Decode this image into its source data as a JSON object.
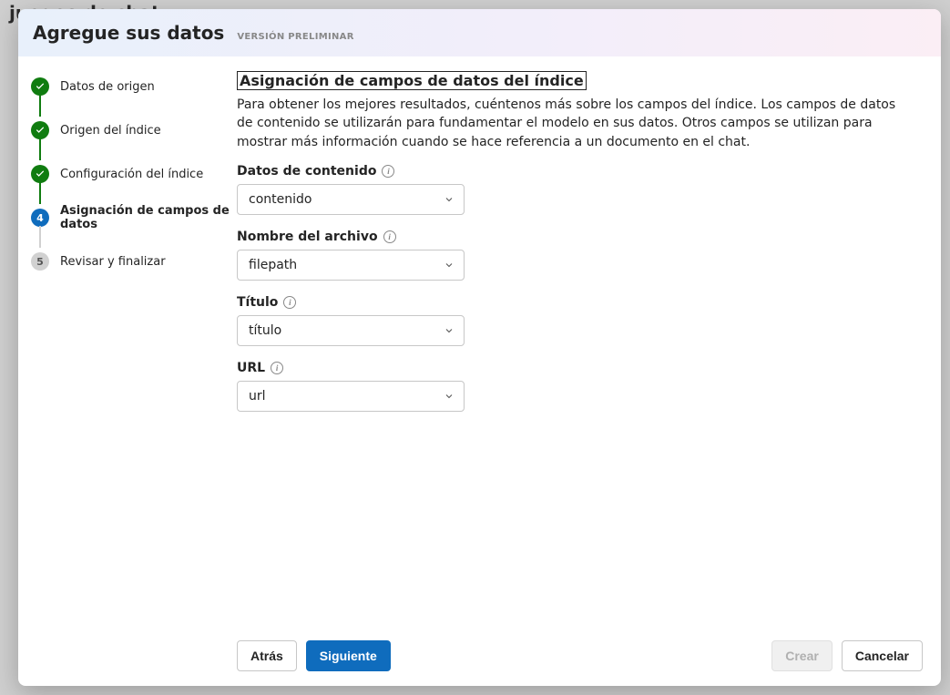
{
  "background": {
    "title": "juegos de chat"
  },
  "header": {
    "title": "Agregue sus datos",
    "badge": "VERSIÓN PRELIMINAR"
  },
  "stepper": {
    "steps": [
      {
        "label": "Datos de origen",
        "state": "done"
      },
      {
        "label": "Origen del índice",
        "state": "done"
      },
      {
        "label": "Configuración del índice",
        "state": "done"
      },
      {
        "label": "Asignación de campos de datos",
        "state": "active",
        "num": "4"
      },
      {
        "label": "Revisar y finalizar",
        "state": "pending",
        "num": "5"
      }
    ]
  },
  "main": {
    "heading": "Asignación de campos de datos del índice",
    "description": "Para obtener los mejores resultados, cuéntenos más sobre los campos del índice. Los campos de datos de contenido se utilizarán para fundamentar el modelo en sus datos. Otros campos se utilizan para mostrar más información cuando se hace referencia a un documento en el chat.",
    "fields": [
      {
        "label": "Datos de contenido",
        "value": "contenido"
      },
      {
        "label": "Nombre del archivo",
        "value": "filepath"
      },
      {
        "label": "Título",
        "value": "título"
      },
      {
        "label": "URL",
        "value": "url"
      }
    ]
  },
  "footer": {
    "back": "Atrás",
    "next": "Siguiente",
    "create": "Crear",
    "cancel": "Cancelar"
  }
}
